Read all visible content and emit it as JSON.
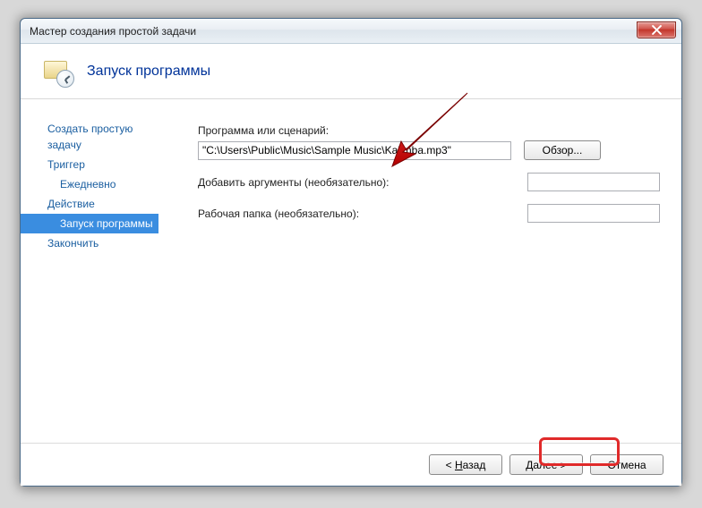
{
  "window": {
    "title": "Мастер создания простой задачи"
  },
  "header": {
    "title": "Запуск программы"
  },
  "sidebar": {
    "items": [
      {
        "label": "Создать простую задачу"
      },
      {
        "label": "Триггер"
      },
      {
        "label": "Ежедневно"
      },
      {
        "label": "Действие"
      },
      {
        "label": "Запуск программы"
      },
      {
        "label": "Закончить"
      }
    ]
  },
  "form": {
    "program_label": "Программа или сценарий:",
    "program_value": "\"C:\\Users\\Public\\Music\\Sample Music\\Kalimba.mp3\"",
    "browse_label": "Обзор...",
    "args_label": "Добавить аргументы (необязательно):",
    "args_value": "",
    "startin_label": "Рабочая папка (необязательно):",
    "startin_value": ""
  },
  "buttons": {
    "back_prefix": "< ",
    "back_ul": "Н",
    "back_suffix": "азад",
    "next_prefix": "",
    "next_ul": "Д",
    "next_suffix": "алее >",
    "cancel": "Отмена"
  },
  "colors": {
    "accent": "#3a8de0",
    "link": "#1a5ea0",
    "highlight": "#e02a2a"
  }
}
